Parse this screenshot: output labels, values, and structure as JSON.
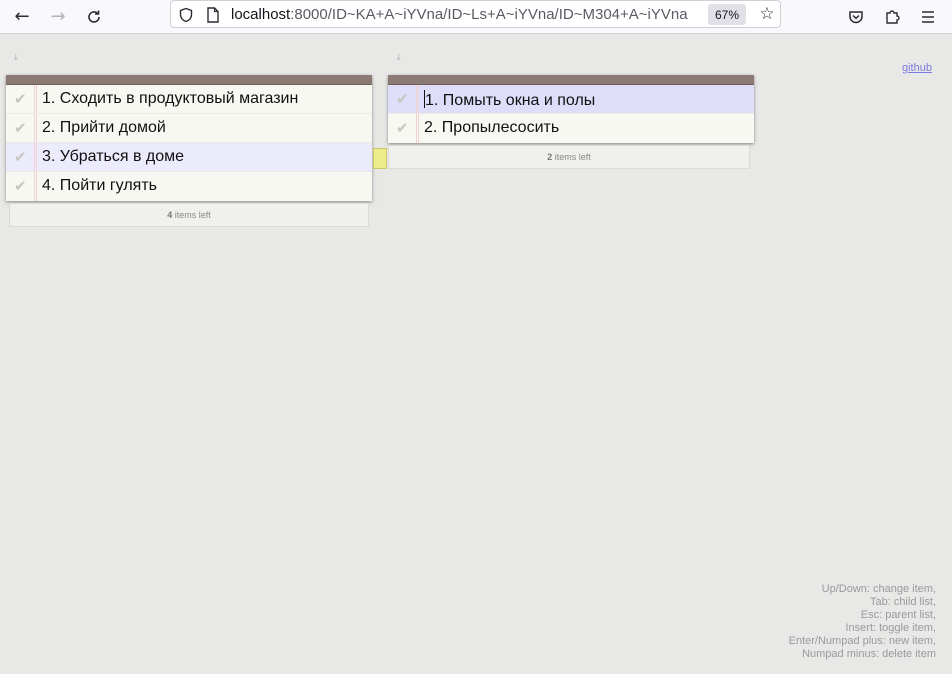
{
  "browser": {
    "url_host": "localhost",
    "url_rest": ":8000/ID~KA+A~iYVna/ID~Ls+A~iYVna/ID~M304+A~iYVna",
    "zoom": "67%",
    "icons": {
      "back": "arrow-left-icon",
      "forward": "arrow-right-icon",
      "reload": "reload-icon",
      "shield": "shield-icon",
      "page": "page-icon",
      "star": "star-icon",
      "pocket": "pocket-icon",
      "extensions": "puzzle-icon",
      "menu": "hamburger-menu-icon"
    }
  },
  "page": {
    "github_label": "github",
    "lists": [
      {
        "items": [
          {
            "text": "1. Сходить в продуктовый магазин"
          },
          {
            "text": "2. Прийти домой"
          },
          {
            "text": "3. Убраться в доме"
          },
          {
            "text": "4. Пойти гулять"
          }
        ],
        "footer_count": "4",
        "footer_text": " items left"
      },
      {
        "items": [
          {
            "text": "1. Помыть окна и полы"
          },
          {
            "text": "2. Пропылесосить"
          }
        ],
        "footer_count": "2",
        "footer_text": " items left"
      }
    ],
    "help_lines": [
      "Up/Down: change item,",
      "Tab: child list,",
      "Esc: parent list,",
      "Insert: toggle item,",
      "Enter/Numpad plus: new item,",
      "Numpad minus: delete item"
    ]
  },
  "colors": {
    "header_bar": "#8a7a73",
    "active_row": "#dedefa",
    "highlight_row": "#ebebfb",
    "link": "#7a7ae0"
  }
}
